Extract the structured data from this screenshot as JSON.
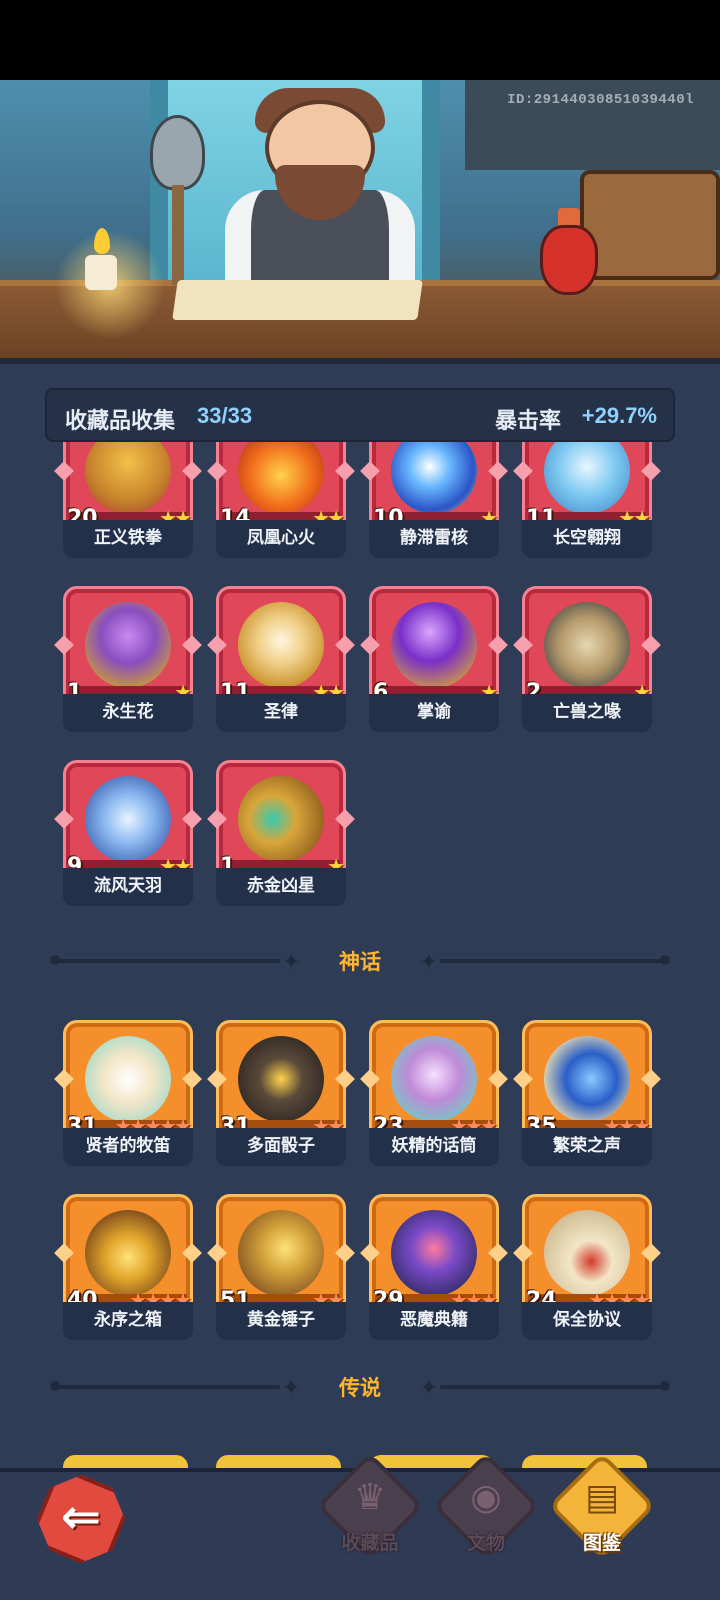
{
  "banner": {
    "player_id": "ID:29144030851039440l"
  },
  "header": {
    "title": "收藏品收集",
    "count": "33/33",
    "crit_label": "暴击率",
    "crit_value": "+29.7%"
  },
  "epic_items": [
    {
      "name": "正义铁拳",
      "level": "20",
      "stars": "★★"
    },
    {
      "name": "凤凰心火",
      "level": "14",
      "stars": "★★"
    },
    {
      "name": "静滞雷核",
      "level": "10",
      "stars": "★"
    },
    {
      "name": "长空翱翔",
      "level": "11",
      "stars": "★★"
    },
    {
      "name": "永生花",
      "level": "1",
      "stars": "★"
    },
    {
      "name": "圣律",
      "level": "11",
      "stars": "★★"
    },
    {
      "name": "掌谕",
      "level": "6",
      "stars": "★"
    },
    {
      "name": "亡兽之喙",
      "level": "2",
      "stars": "★"
    },
    {
      "name": "流风天羽",
      "level": "9",
      "stars": "★★"
    },
    {
      "name": "赤金凶星",
      "level": "1",
      "stars": "★"
    }
  ],
  "sections": {
    "mythic": "神话",
    "legendary": "传说"
  },
  "mythic_items": [
    {
      "name": "贤者的牧笛",
      "level": "31",
      "stars": "★★★★★"
    },
    {
      "name": "多面骰子",
      "level": "31",
      "stars": "★★"
    },
    {
      "name": "妖精的话筒",
      "level": "23",
      "stars": "★★★"
    },
    {
      "name": "繁荣之声",
      "level": "35",
      "stars": "★★★"
    },
    {
      "name": "永序之箱",
      "level": "40",
      "stars": "★★★★"
    },
    {
      "name": "黄金锤子",
      "level": "51",
      "stars": "★★"
    },
    {
      "name": "恶魔典籍",
      "level": "29",
      "stars": "★★★"
    },
    {
      "name": "保全协议",
      "level": "24",
      "stars": "★★★★"
    }
  ],
  "nav": {
    "back_icon": "back-arrow-icon",
    "collectibles": "收藏品",
    "relics": "文物",
    "codex": "图鉴"
  },
  "colors": {
    "epic_card": "#e0485a",
    "mythic_card": "#f48f2c",
    "accent_blue": "#8fd0ff",
    "section_gold": "#ffb52e"
  }
}
